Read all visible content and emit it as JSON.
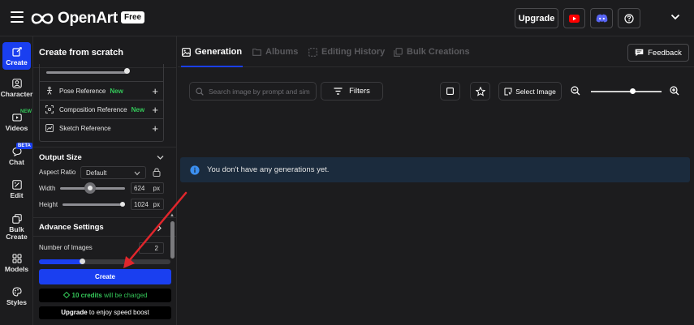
{
  "header": {
    "brand": "OpenArt",
    "plan_badge": "Free",
    "upgrade_label": "Upgrade",
    "icons": [
      "menu-icon",
      "youtube-icon",
      "discord-icon",
      "help-icon",
      "chevron-down-icon"
    ]
  },
  "rail": {
    "items": [
      {
        "label": "Create",
        "icon": "create-icon",
        "active": true
      },
      {
        "label": "Character",
        "icon": "character-icon"
      },
      {
        "label": "Videos",
        "icon": "videos-icon",
        "badge": "NEW",
        "badge_color": "#34c759"
      },
      {
        "label": "Chat",
        "icon": "chat-icon",
        "badge": "BETA",
        "badge_color": "#1a3ff0"
      },
      {
        "label": "Edit",
        "icon": "edit-icon"
      },
      {
        "label": "Bulk",
        "label2": "Create",
        "icon": "bulk-create-icon"
      },
      {
        "label": "Models",
        "icon": "models-icon"
      },
      {
        "label": "Styles",
        "icon": "styles-icon"
      }
    ]
  },
  "panel": {
    "title": "Create from scratch",
    "references": [
      {
        "label": "Pose Reference",
        "new": "New"
      },
      {
        "label": "Composition Reference",
        "new": "New"
      },
      {
        "label": "Sketch Reference",
        "new": ""
      }
    ],
    "output_size": {
      "title": "Output Size",
      "aspect_label": "Aspect Ratio",
      "aspect_value": "Default",
      "width_label": "Width",
      "width_value": "624",
      "height_label": "Height",
      "height_value": "1024",
      "unit": "px"
    },
    "advance": {
      "title": "Advance Settings",
      "images_label": "Number of Images",
      "images_value": "2",
      "images_fraction": 0.33
    },
    "create_label": "Create",
    "credits_amount": "10 credits",
    "credits_suffix": " will be charged",
    "upgrade_word": "Upgrade",
    "speed_suffix": " to enjoy speed boost"
  },
  "main": {
    "tabs": [
      {
        "label": "Generation",
        "active": true
      },
      {
        "label": "Albums"
      },
      {
        "label": "Editing History"
      },
      {
        "label": "Bulk Creations"
      }
    ],
    "feedback_label": "Feedback",
    "search_placeholder": "Search image by prompt and simila",
    "filters_label": "Filters",
    "select_image_label": "Select Image",
    "zoom_fraction": 0.55,
    "empty_message": "You don't have any generations yet."
  },
  "colors": {
    "accent": "#1a3ff0",
    "new_green": "#34c759",
    "notice_bg": "#1b2b3d",
    "arrow": "#e0262c"
  }
}
